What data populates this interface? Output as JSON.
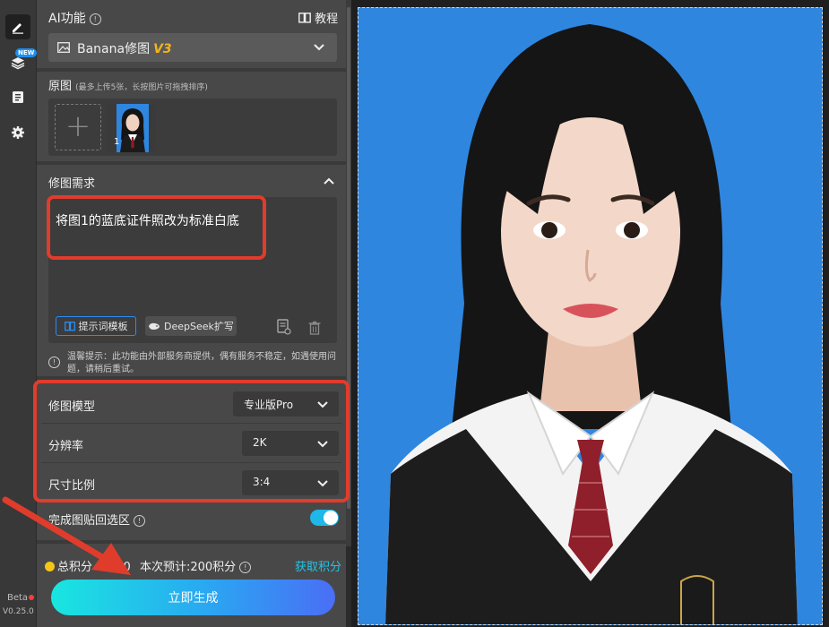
{
  "rail": {
    "new_badge": "NEW",
    "beta_label": "Beta",
    "version": "V0.25.0"
  },
  "ai_function": {
    "label": "AI功能",
    "tutorial_label": "教程",
    "selected": "Banana修图",
    "selected_version": "V3"
  },
  "original": {
    "label": "原图",
    "hint": "(最多上传5张，长按图片可拖拽排序)",
    "thumb_index": "1"
  },
  "requirement": {
    "label": "修图需求",
    "prompt_text": "将图1的蓝底证件照改为标准白底",
    "template_button": "提示词模板",
    "deepseek_button": "DeepSeek扩写"
  },
  "notice": "温馨提示：此功能由外部服务商提供，偶有服务不稳定，如遇使用问题，请稍后重试。",
  "settings": {
    "model_label": "修图模型",
    "model_value": "专业版Pro",
    "resolution_label": "分辨率",
    "resolution_value": "2K",
    "ratio_label": "尺寸比例",
    "ratio_value": "3:4",
    "paste_back_label": "完成图贴回选区",
    "paste_back_enabled": true
  },
  "footer": {
    "total_points_label": "总积分",
    "total_points_value": "100",
    "estimate_label": "本次预计:200积分",
    "get_points": "获取积分",
    "generate_button": "立即生成"
  },
  "colors": {
    "accent_blue": "#2d8cf0",
    "highlight_red": "#e03c2c",
    "toggle_on": "#1fb7e8",
    "photo_background": "#2f86df",
    "version_gold": "#f3b31b"
  }
}
